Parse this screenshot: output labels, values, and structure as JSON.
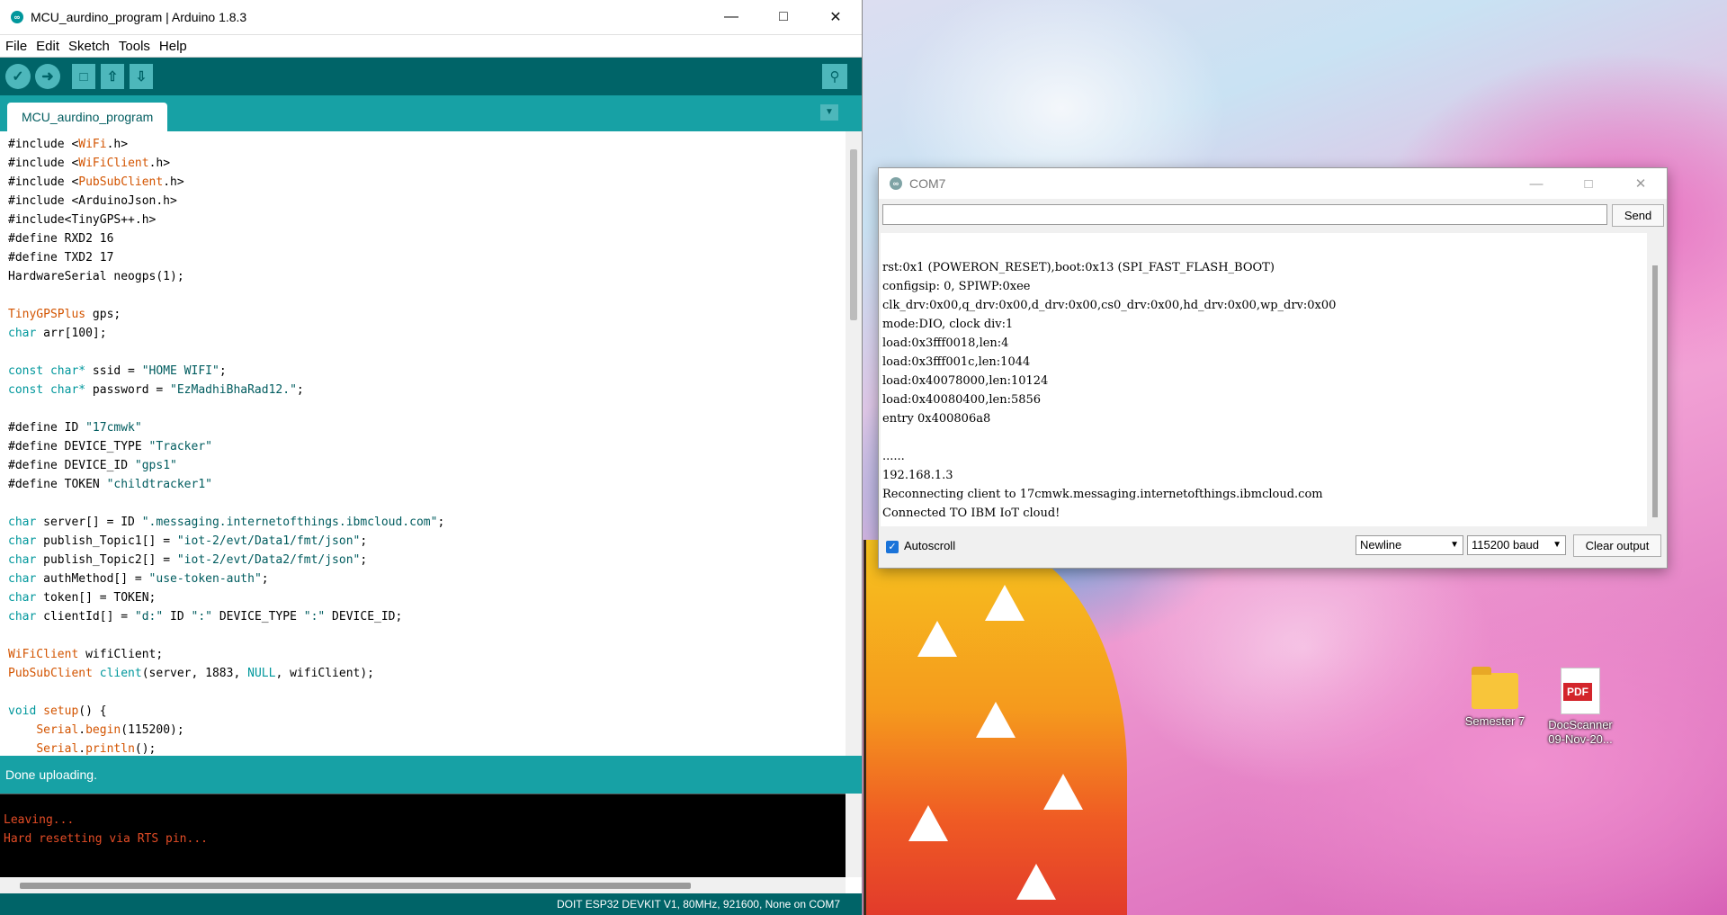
{
  "ide": {
    "title": "MCU_aurdino_program | Arduino 1.8.3",
    "menu": [
      "File",
      "Edit",
      "Sketch",
      "Tools",
      "Help"
    ],
    "tab": "MCU_aurdino_program",
    "status": "Done uploading.",
    "console_lines": [
      "Leaving...",
      "Hard resetting via RTS pin..."
    ],
    "board_info": "DOIT ESP32 DEVKIT V1, 80MHz, 921600, None on COM7",
    "code_lines": [
      "#include <WiFi.h>",
      "#include <WiFiClient.h>",
      "#include <PubSubClient.h>",
      "#include <ArduinoJson.h>",
      "#include<TinyGPS++.h>",
      "#define RXD2 16",
      "#define TXD2 17",
      "HardwareSerial neogps(1);",
      "",
      "TinyGPSPlus gps;",
      "char arr[100];",
      "",
      "const char* ssid = \"HOME WIFI\";",
      "const char* password = \"EzMadhiBhaRad12.\";",
      "",
      "#define ID \"17cmwk\"",
      "#define DEVICE_TYPE \"Tracker\"",
      "#define DEVICE_ID \"gps1\"",
      "#define TOKEN \"childtracker1\"",
      "",
      "char server[] = ID \".messaging.internetofthings.ibmcloud.com\";",
      "char publish_Topic1[] = \"iot-2/evt/Data1/fmt/json\";",
      "char publish_Topic2[] = \"iot-2/evt/Data2/fmt/json\";",
      "char authMethod[] = \"use-token-auth\";",
      "char token[] = TOKEN;",
      "char clientId[] = \"d:\" ID \":\" DEVICE_TYPE \":\" DEVICE_ID;",
      "",
      "WiFiClient wifiClient;",
      "PubSubClient client(server, 1883, NULL, wifiClient);",
      "",
      "void setup() {",
      "    Serial.begin(115200);",
      "    Serial.println();"
    ]
  },
  "serial": {
    "title": "COM7",
    "send_label": "Send",
    "output_lines": [
      "rst:0x1 (POWERON_RESET),boot:0x13 (SPI_FAST_FLASH_BOOT)",
      "configsip: 0, SPIWP:0xee",
      "clk_drv:0x00,q_drv:0x00,d_drv:0x00,cs0_drv:0x00,hd_drv:0x00,wp_drv:0x00",
      "mode:DIO, clock div:1",
      "load:0x3fff0018,len:4",
      "load:0x3fff001c,len:1044",
      "load:0x40078000,len:10124",
      "load:0x40080400,len:5856",
      "entry 0x400806a8",
      "",
      "......",
      "192.168.1.3",
      "Reconnecting client to 17cmwk.messaging.internetofthings.ibmcloud.com",
      "Connected TO IBM IoT cloud!"
    ],
    "autoscroll_label": "Autoscroll",
    "autoscroll_checked": true,
    "line_ending": "Newline",
    "baud": "115200 baud",
    "clear_label": "Clear output"
  },
  "desktop": {
    "icons": [
      {
        "label": "Semester 7",
        "icon": "folder-icon"
      },
      {
        "label": "DocScanner 09-Nov-20...",
        "icon": "pdf-icon"
      }
    ]
  },
  "colors": {
    "teal_dark": "#006468",
    "teal_mid": "#17a1a5",
    "teal_light": "#4db7bb",
    "console_text": "#e34c26"
  }
}
